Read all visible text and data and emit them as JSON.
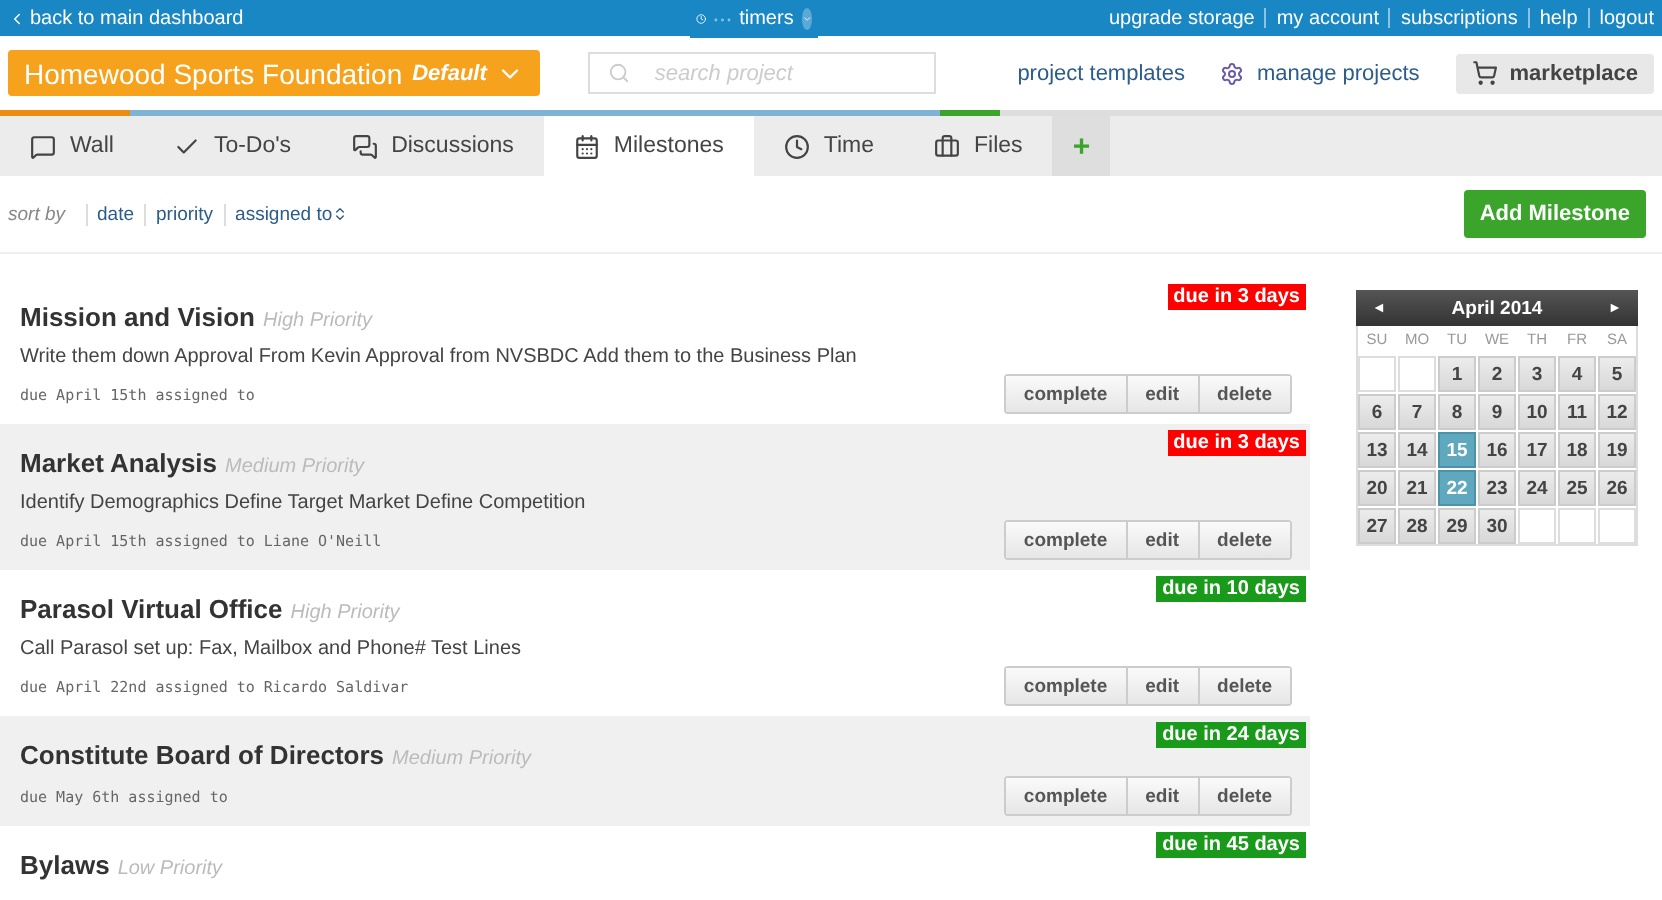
{
  "top_bar": {
    "back_link": "back to main dashboard",
    "timers": "timers",
    "links": [
      "upgrade storage",
      "my account",
      "subscriptions",
      "help",
      "logout"
    ]
  },
  "header": {
    "project": "Homewood Sports Foundation",
    "project_tag": "Default",
    "search": {
      "placeholder": "search project"
    },
    "project_templates": "project templates",
    "manage_projects": "manage projects",
    "marketplace": "marketplace"
  },
  "tabs": [
    {
      "kind": "wall",
      "label": "Wall",
      "selected": false
    },
    {
      "kind": "todos",
      "label": "To-Do's",
      "selected": false
    },
    {
      "kind": "discussions",
      "label": "Discussions",
      "selected": false
    },
    {
      "kind": "milestones",
      "label": "Milestones",
      "selected": true
    },
    {
      "kind": "time",
      "label": "Time",
      "selected": false
    },
    {
      "kind": "files",
      "label": "Files",
      "selected": false
    },
    {
      "kind": "add",
      "label": "+",
      "selected": false
    }
  ],
  "sort": {
    "label": "sort by",
    "options": [
      "date",
      "priority",
      "assigned to"
    ]
  },
  "add_button": "Add Milestone",
  "milestones": [
    {
      "title": "Mission and Vision",
      "priority": "High Priority",
      "description": "Write them down Approval From Kevin Approval from NVSBDC Add them to the Business Plan",
      "meta": "due April 15th assigned to",
      "buttons": [
        "complete",
        "edit",
        "delete"
      ],
      "due": "due in 3 days",
      "color": "#ff0000"
    },
    {
      "title": "Market Analysis",
      "priority": "Medium Priority",
      "description": "Identify Demographics Define Target Market Define Competition",
      "meta": "due April 15th assigned to Liane O'Neill",
      "buttons": [
        "complete",
        "edit",
        "delete"
      ],
      "due": "due in 3 days",
      "color": "#ff0000"
    },
    {
      "title": "Parasol Virtual Office",
      "priority": "High Priority",
      "description": "Call Parasol set up: Fax, Mailbox and Phone# Test Lines",
      "meta": "due April 22nd assigned to Ricardo Saldivar",
      "buttons": [
        "complete",
        "edit",
        "delete"
      ],
      "due": "due in 10 days",
      "color": "#1a9a1a"
    },
    {
      "title": "Constitute Board of Directors",
      "priority": "Medium Priority",
      "meta": "due May 6th assigned to",
      "buttons": [
        "complete",
        "edit",
        "delete"
      ],
      "due": "due in 24 days",
      "color": "#1a9a1a"
    },
    {
      "title": "Bylaws",
      "priority": "Low Priority",
      "due": "due in 45 days",
      "color": "#1a9a1a"
    }
  ],
  "calendar": {
    "prev": "◄",
    "title": "April 2014",
    "next": "►",
    "weekdays": [
      "SU",
      "MO",
      "TU",
      "WE",
      "TH",
      "FR",
      "SA"
    ],
    "weeks": [
      [
        {
          "kind": "blank"
        },
        {
          "kind": "blank"
        },
        {
          "day": "1",
          "selected": false
        },
        {
          "day": "2",
          "selected": false
        },
        {
          "day": "3",
          "selected": false
        },
        {
          "day": "4",
          "selected": false
        },
        {
          "day": "5",
          "selected": false
        }
      ],
      [
        {
          "day": "6",
          "selected": false
        },
        {
          "day": "7",
          "selected": false
        },
        {
          "day": "8",
          "selected": false
        },
        {
          "day": "9",
          "selected": false
        },
        {
          "day": "10",
          "selected": false
        },
        {
          "day": "11",
          "selected": false
        },
        {
          "day": "12",
          "selected": false
        }
      ],
      [
        {
          "day": "13",
          "selected": false
        },
        {
          "day": "14",
          "selected": false
        },
        {
          "day": "15",
          "selected": true
        },
        {
          "day": "16",
          "selected": false
        },
        {
          "day": "17",
          "selected": false
        },
        {
          "day": "18",
          "selected": false
        },
        {
          "day": "19",
          "selected": false
        }
      ],
      [
        {
          "day": "20",
          "selected": false
        },
        {
          "day": "21",
          "selected": false
        },
        {
          "day": "22",
          "selected": true
        },
        {
          "day": "23",
          "selected": false
        },
        {
          "day": "24",
          "selected": false
        },
        {
          "day": "25",
          "selected": false
        },
        {
          "day": "26",
          "selected": false
        }
      ],
      [
        {
          "day": "27",
          "selected": false
        },
        {
          "day": "28",
          "selected": false
        },
        {
          "day": "29",
          "selected": false
        },
        {
          "day": "30",
          "selected": false
        },
        {
          "kind": "blank"
        },
        {
          "kind": "blank"
        },
        {
          "kind": "blank"
        }
      ]
    ]
  }
}
